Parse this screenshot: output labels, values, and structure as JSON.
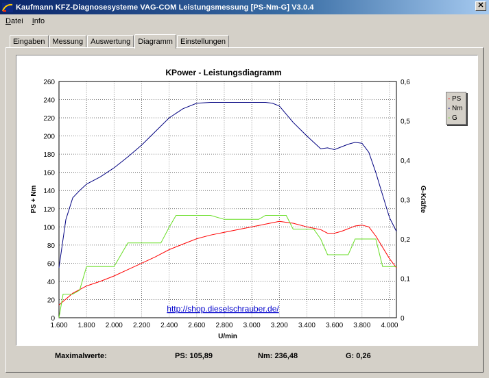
{
  "window": {
    "title": "Kaufmann KFZ-Diagnosesysteme  VAG-COM  Leistungsmessung [PS-Nm-G] V3.0.4",
    "close_glyph": "✕"
  },
  "menu": [
    {
      "label": "Datei",
      "accel": "D",
      "rest": "atei"
    },
    {
      "label": "Info",
      "accel": "I",
      "rest": "nfo"
    }
  ],
  "tabs": [
    "Eingaben",
    "Messung",
    "Auswertung",
    "Diagramm",
    "Einstellungen"
  ],
  "active_tab": "Diagramm",
  "link": "http://shop.dieselschrauber.de/",
  "legend": [
    {
      "label": "PS",
      "color": "#ff0000"
    },
    {
      "label": "Nm",
      "color": "#000080"
    },
    {
      "label": "G",
      "color": "#66dd22"
    }
  ],
  "footer": {
    "label": "Maximalwerte:",
    "ps": "PS: 105,89",
    "nm": "Nm: 236,48",
    "g": "G: 0,26"
  },
  "chart_data": {
    "type": "line",
    "title": "KPower - Leistungsdiagramm",
    "xlabel": "U/min",
    "ylabel": "PS + Nm",
    "y2label": "G-Kräfte",
    "xlim": [
      1600,
      4050
    ],
    "ylim": [
      0,
      260
    ],
    "y2lim": [
      0,
      0.6
    ],
    "x_ticks": [
      "1.600",
      "1.800",
      "2.000",
      "2.200",
      "2.400",
      "2.600",
      "2.800",
      "3.000",
      "3.200",
      "3.400",
      "3.600",
      "3.800",
      "4.000"
    ],
    "y_ticks": [
      "0",
      "20",
      "40",
      "60",
      "80",
      "100",
      "120",
      "140",
      "160",
      "180",
      "200",
      "220",
      "240",
      "260"
    ],
    "y2_ticks": [
      "0",
      "0,1",
      "0,2",
      "0,3",
      "0,4",
      "0,5",
      "0,6"
    ],
    "grid": true,
    "legend_position": "right",
    "series": [
      {
        "name": "PS",
        "color": "#ff0000",
        "axis": "left",
        "x": [
          1600,
          1700,
          1800,
          1900,
          2000,
          2100,
          2200,
          2300,
          2400,
          2500,
          2600,
          2700,
          2800,
          2900,
          3000,
          3100,
          3200,
          3300,
          3400,
          3500,
          3550,
          3600,
          3650,
          3700,
          3750,
          3800,
          3850,
          3900,
          4000,
          4050
        ],
        "y": [
          14,
          27,
          35,
          40,
          46,
          53,
          60,
          67,
          75,
          81,
          87,
          91,
          94,
          97,
          100,
          103,
          106,
          104,
          100,
          97,
          93,
          93,
          95,
          98,
          101,
          102,
          100,
          90,
          65,
          55
        ]
      },
      {
        "name": "Nm",
        "color": "#000080",
        "axis": "left",
        "x": [
          1600,
          1650,
          1700,
          1750,
          1800,
          1900,
          2000,
          2100,
          2200,
          2300,
          2400,
          2500,
          2600,
          2700,
          2800,
          2900,
          3000,
          3100,
          3150,
          3200,
          3300,
          3400,
          3450,
          3500,
          3550,
          3600,
          3650,
          3700,
          3750,
          3800,
          3850,
          3900,
          3950,
          4000,
          4050
        ],
        "y": [
          55,
          108,
          132,
          140,
          147,
          155,
          165,
          177,
          190,
          205,
          220,
          230,
          236,
          237,
          237,
          237,
          237,
          237,
          236,
          233,
          215,
          200,
          193,
          186,
          187,
          185,
          188,
          191,
          193,
          192,
          182,
          160,
          135,
          110,
          95
        ]
      },
      {
        "name": "G",
        "color": "#66dd22",
        "axis": "right",
        "x": [
          1600,
          1630,
          1650,
          1700,
          1750,
          1800,
          1900,
          1990,
          2000,
          2100,
          2200,
          2340,
          2400,
          2450,
          2500,
          2600,
          2700,
          2800,
          2900,
          3000,
          3050,
          3100,
          3200,
          3250,
          3300,
          3400,
          3450,
          3500,
          3550,
          3600,
          3650,
          3700,
          3750,
          3800,
          3850,
          3900,
          3950,
          4000,
          4050
        ],
        "y": [
          0,
          0.06,
          0.06,
          0.06,
          0.07,
          0.13,
          0.13,
          0.13,
          0.13,
          0.19,
          0.19,
          0.19,
          0.23,
          0.26,
          0.26,
          0.26,
          0.26,
          0.25,
          0.25,
          0.25,
          0.25,
          0.26,
          0.26,
          0.26,
          0.225,
          0.225,
          0.225,
          0.2,
          0.16,
          0.16,
          0.16,
          0.16,
          0.2,
          0.2,
          0.2,
          0.2,
          0.13,
          0.13,
          0.13
        ]
      }
    ]
  }
}
